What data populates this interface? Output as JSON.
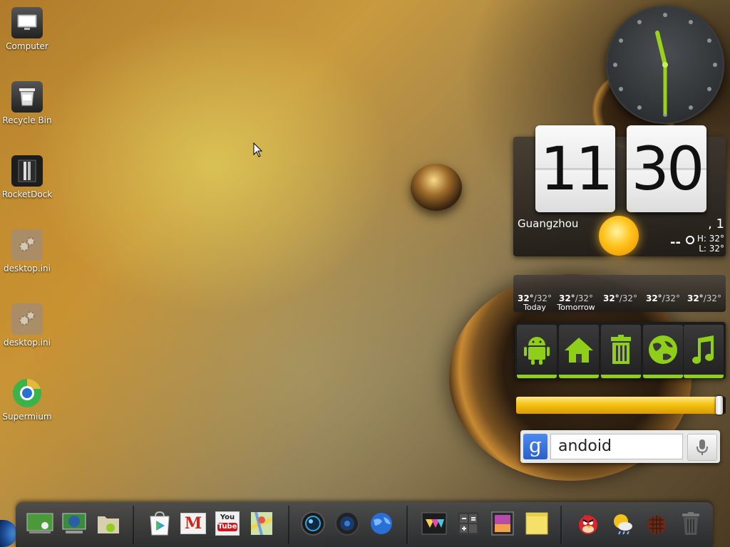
{
  "desktop": {
    "icons": [
      {
        "label": "Computer",
        "icon": "computer-icon"
      },
      {
        "label": "Recycle Bin",
        "icon": "recycle-bin-icon"
      },
      {
        "label": "RocketDock",
        "icon": "rocketdock-icon"
      },
      {
        "label": "desktop.ini",
        "icon": "settings-file-icon"
      },
      {
        "label": "desktop.ini",
        "icon": "settings-file-icon"
      },
      {
        "label": "Supermium",
        "icon": "supermium-browser-icon"
      }
    ]
  },
  "clock": {
    "hour": "11",
    "minute": "30"
  },
  "weather": {
    "city": "Guangzhou",
    "date_fragment": ", 1",
    "current_temp": "--",
    "high": "H: 32°",
    "low": "L: 32°",
    "condition_icon": "sun-icon",
    "forecast": [
      {
        "hi": "32°",
        "lo": "/32°",
        "day": "Today"
      },
      {
        "hi": "32°",
        "lo": "/32°",
        "day": "Tomorrow"
      },
      {
        "hi": "32°",
        "lo": "/32°",
        "day": ""
      },
      {
        "hi": "32°",
        "lo": "/32°",
        "day": ""
      },
      {
        "hi": "32°",
        "lo": "/32°",
        "day": ""
      }
    ]
  },
  "shortcuts": [
    {
      "icon": "android-icon"
    },
    {
      "icon": "home-icon"
    },
    {
      "icon": "trash-icon"
    },
    {
      "icon": "globe-icon"
    },
    {
      "icon": "music-icon"
    }
  ],
  "progress": {
    "value": 0.97,
    "color": "#f4c313"
  },
  "search": {
    "value": "andoid",
    "brand_letter": "g"
  },
  "dock": {
    "items": [
      {
        "icon": "android-screen-icon"
      },
      {
        "icon": "network-icon"
      },
      {
        "icon": "android-folder-icon"
      },
      {
        "icon": "play-store-icon"
      },
      {
        "icon": "gmail-icon",
        "text": "M"
      },
      {
        "icon": "youtube-icon",
        "text1": "You",
        "text2": "Tube"
      },
      {
        "icon": "maps-icon"
      },
      {
        "icon": "camera-lens-icon"
      },
      {
        "icon": "speaker-icon"
      },
      {
        "icon": "browser-globe-icon"
      },
      {
        "icon": "media-store-icon"
      },
      {
        "icon": "calculator-icon"
      },
      {
        "icon": "gallery-icon"
      },
      {
        "icon": "notes-icon"
      },
      {
        "icon": "angry-birds-icon"
      },
      {
        "icon": "weather-app-icon"
      },
      {
        "icon": "basket-icon"
      },
      {
        "icon": "trash-can-icon"
      }
    ]
  },
  "colors": {
    "accent_green": "#8fcf1a",
    "clock_hand": "#9ad21a",
    "bar_yellow": "#f4c313"
  }
}
